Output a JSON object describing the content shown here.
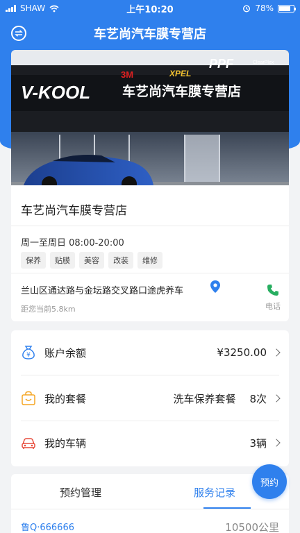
{
  "status_bar": {
    "carrier": "SHAW",
    "time": "上午10:20",
    "battery": "78%",
    "battery_level": 0.78
  },
  "nav": {
    "title": "车艺尚汽车膜专营店"
  },
  "banner": {
    "brand_left": "V-KOOL",
    "brand_3m": "3M",
    "brand_xpel": "XPEL",
    "brand_ppf": "PPF",
    "brand_clearplex": "ClearPlex",
    "sign_text": "车艺尚汽车膜专营店"
  },
  "store": {
    "name": "车艺尚汽车膜专营店",
    "hours": "周一至周日 08:00-20:00",
    "tags": [
      "保养",
      "贴膜",
      "美容",
      "改装",
      "维修"
    ],
    "address": "兰山区通达路与金坛路交叉路口途虎养车",
    "distance": "距您当前5.8km",
    "phone_label": "电话"
  },
  "account": {
    "balance_label": "账户余额",
    "balance_value": "¥3250.00",
    "package_label": "我的套餐",
    "package_name": "洗车保养套餐",
    "package_count": "8次",
    "vehicle_label": "我的车辆",
    "vehicle_count": "3辆"
  },
  "tabs": {
    "tab1": "预约管理",
    "tab2": "服务记录",
    "active": "服务记录"
  },
  "record": {
    "plate": "鲁Q·666666",
    "mileage": "10500公里"
  },
  "fab": {
    "label": "预约"
  },
  "colors": {
    "accent": "#2f80ed",
    "phone_green": "#27ae60",
    "package_orange": "#f5a623",
    "vehicle_red": "#e74c3c"
  }
}
